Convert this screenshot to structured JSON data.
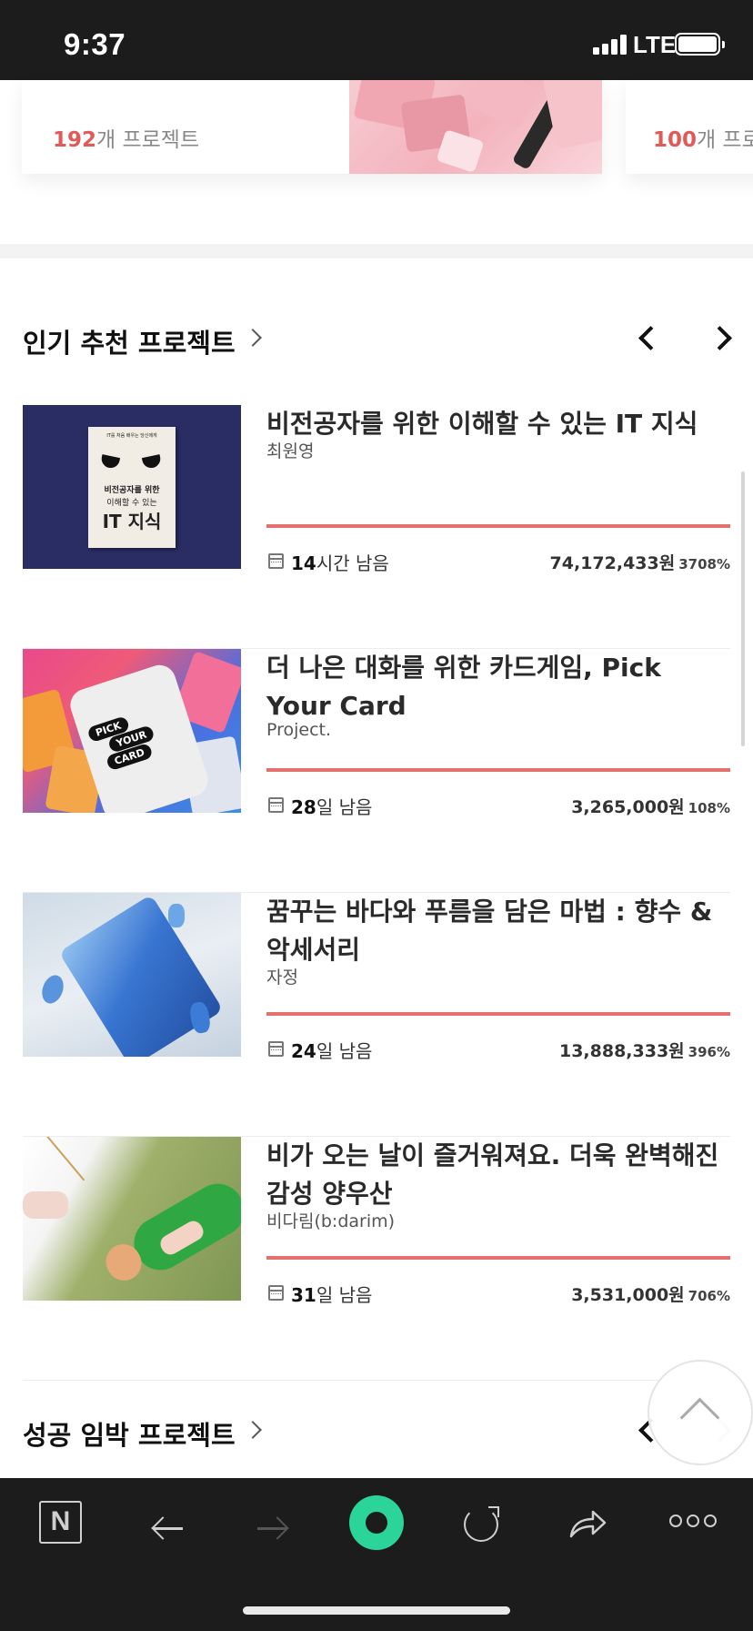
{
  "status_bar": {
    "time": "9:37",
    "network": "LTE"
  },
  "categories": [
    {
      "count": "192",
      "suffix": "개 프로젝트"
    },
    {
      "count": "100",
      "suffix": "개 프로"
    }
  ],
  "popular": {
    "title": "인기 추천 프로젝트",
    "projects": [
      {
        "title": "비전공자를 위한 이해할 수 있는 IT 지식",
        "creator": "최원영",
        "days": "14",
        "days_suffix": "시간 남음",
        "amount": "74,172,433원",
        "percent": "3708%"
      },
      {
        "title": "더 나은 대화를 위한 카드게임, Pick Your Card",
        "creator": "Project.",
        "days": "28",
        "days_suffix": "일 남음",
        "amount": "3,265,000원",
        "percent": "108%"
      },
      {
        "title": "꿈꾸는 바다와 푸름을 담은 마법 : 향수 & 악세서리",
        "creator": "자정",
        "days": "24",
        "days_suffix": "일 남음",
        "amount": "13,888,333원",
        "percent": "396%"
      },
      {
        "title": "비가 오는 날이 즐거워져요. 더욱 완벽해진 감성 양우산",
        "creator": "비다림(b:darim)",
        "days": "31",
        "days_suffix": "일 남음",
        "amount": "3,531,000원",
        "percent": "706%"
      }
    ]
  },
  "imminent": {
    "title": "성공 임박 프로젝트"
  },
  "book_cover": {
    "top_text": "IT를 처음 배우는 당신에게",
    "line1": "비전공자를 위한",
    "line2": "이해할 수 있는",
    "line3": "IT 지식"
  },
  "card_box": {
    "line1": "PICK",
    "line2": "YOUR",
    "line3": "CARD"
  },
  "toolbar": {
    "n_label": "N"
  },
  "colors": {
    "accent": "#e05a58",
    "bar": "#e5716e",
    "toolbar_bg": "#1c1c1c",
    "green": "#2bd59a"
  }
}
